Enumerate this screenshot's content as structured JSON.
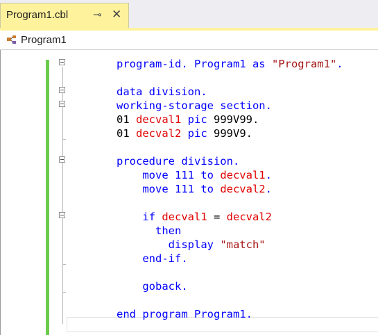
{
  "tab": {
    "title": "Program1.cbl",
    "pin_glyph": "⊸",
    "close_glyph": "✕"
  },
  "navbar": {
    "label": "Program1",
    "icon": "class-icon"
  },
  "code": [
    [
      {
        "t": "kw",
        "v": "program-id. "
      },
      {
        "t": "kw",
        "v": "Program1"
      },
      {
        "t": "kw",
        "v": " as "
      },
      {
        "t": "str",
        "v": "\"Program1\""
      },
      {
        "t": "kw",
        "v": "."
      }
    ],
    [],
    [
      {
        "t": "kw",
        "v": "data division."
      }
    ],
    [
      {
        "t": "kw",
        "v": "working-storage section."
      }
    ],
    [
      {
        "t": "p",
        "v": "01 "
      },
      {
        "t": "var",
        "v": "decval1"
      },
      {
        "t": "kw",
        "v": " pic "
      },
      {
        "t": "p",
        "v": "999V99."
      }
    ],
    [
      {
        "t": "p",
        "v": "01 "
      },
      {
        "t": "var",
        "v": "decval2"
      },
      {
        "t": "kw",
        "v": " pic "
      },
      {
        "t": "p",
        "v": "999V9."
      }
    ],
    [],
    [
      {
        "t": "kw",
        "v": "procedure division."
      }
    ],
    [
      {
        "t": "p",
        "v": "    "
      },
      {
        "t": "kw",
        "v": "move 111 to "
      },
      {
        "t": "var",
        "v": "decval1"
      },
      {
        "t": "kw",
        "v": "."
      }
    ],
    [
      {
        "t": "p",
        "v": "    "
      },
      {
        "t": "kw",
        "v": "move 111 to "
      },
      {
        "t": "var",
        "v": "decval2"
      },
      {
        "t": "kw",
        "v": "."
      }
    ],
    [],
    [
      {
        "t": "p",
        "v": "    "
      },
      {
        "t": "kw",
        "v": "if "
      },
      {
        "t": "var",
        "v": "decval1"
      },
      {
        "t": "p",
        "v": " = "
      },
      {
        "t": "var",
        "v": "decval2"
      }
    ],
    [
      {
        "t": "p",
        "v": "      "
      },
      {
        "t": "kw",
        "v": "then"
      }
    ],
    [
      {
        "t": "p",
        "v": "        "
      },
      {
        "t": "kw",
        "v": "display "
      },
      {
        "t": "str",
        "v": "\"match\""
      }
    ],
    [
      {
        "t": "p",
        "v": "    "
      },
      {
        "t": "kw",
        "v": "end-if."
      }
    ],
    [],
    [
      {
        "t": "p",
        "v": "    "
      },
      {
        "t": "kw",
        "v": "goback."
      }
    ],
    [],
    [
      {
        "t": "kw",
        "v": "end program "
      },
      {
        "t": "kw",
        "v": "Program1"
      },
      {
        "t": "kw",
        "v": "."
      }
    ]
  ],
  "colors": {
    "keyword": "#0000ff",
    "variable": "#e00000",
    "string": "#a31515",
    "change_bar": "#6ccb4c",
    "tab_active": "#fff29d"
  }
}
